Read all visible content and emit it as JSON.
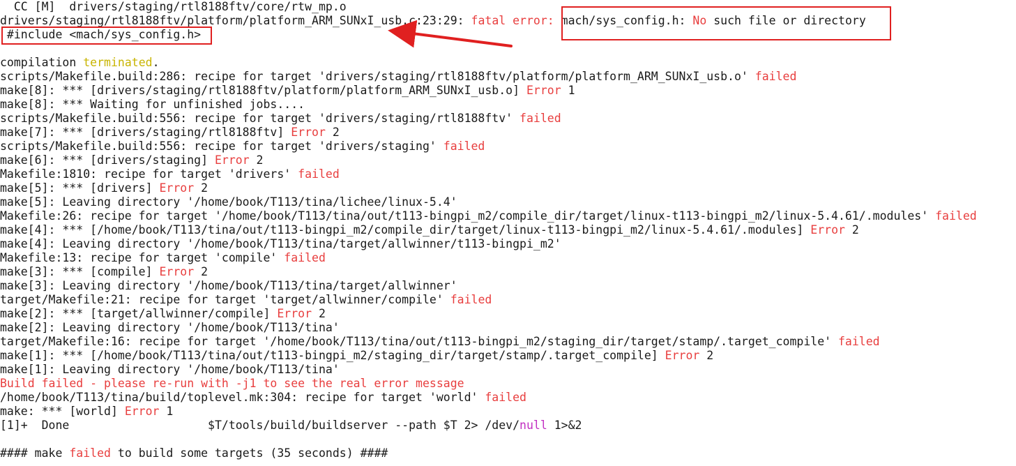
{
  "terminal": {
    "lines": [
      [
        {
          "t": "  CC [M]  drivers/staging/rtl8188ftv/core/rtw_mp.o",
          "c": ""
        }
      ],
      [
        {
          "t": "drivers/staging/rtl8188ftv/platform/platform_ARM_SUNxI_usb.c:23:29: ",
          "c": ""
        },
        {
          "t": "fatal error: ",
          "c": "red"
        },
        {
          "t": "mach/sys_config.h: ",
          "c": ""
        },
        {
          "t": "No",
          "c": "red"
        },
        {
          "t": " such file or directory",
          "c": ""
        }
      ],
      [
        {
          "t": " #include <mach/sys_config.h>",
          "c": ""
        }
      ],
      [
        {
          "t": "",
          "c": ""
        }
      ],
      [
        {
          "t": "compilation ",
          "c": ""
        },
        {
          "t": "terminated",
          "c": "yellow"
        },
        {
          "t": ".",
          "c": ""
        }
      ],
      [
        {
          "t": "scripts/Makefile.build:286: recipe for target 'drivers/staging/rtl8188ftv/platform/platform_ARM_SUNxI_usb.o' ",
          "c": ""
        },
        {
          "t": "failed",
          "c": "red"
        }
      ],
      [
        {
          "t": "make[8]: *** [drivers/staging/rtl8188ftv/platform/platform_ARM_SUNxI_usb.o] ",
          "c": ""
        },
        {
          "t": "Error",
          "c": "red"
        },
        {
          "t": " 1",
          "c": ""
        }
      ],
      [
        {
          "t": "make[8]: *** Waiting for unfinished jobs....",
          "c": ""
        }
      ],
      [
        {
          "t": "scripts/Makefile.build:556: recipe for target 'drivers/staging/rtl8188ftv' ",
          "c": ""
        },
        {
          "t": "failed",
          "c": "red"
        }
      ],
      [
        {
          "t": "make[7]: *** [drivers/staging/rtl8188ftv] ",
          "c": ""
        },
        {
          "t": "Error",
          "c": "red"
        },
        {
          "t": " 2",
          "c": ""
        }
      ],
      [
        {
          "t": "scripts/Makefile.build:556: recipe for target 'drivers/staging' ",
          "c": ""
        },
        {
          "t": "failed",
          "c": "red"
        }
      ],
      [
        {
          "t": "make[6]: *** [drivers/staging] ",
          "c": ""
        },
        {
          "t": "Error",
          "c": "red"
        },
        {
          "t": " 2",
          "c": ""
        }
      ],
      [
        {
          "t": "Makefile:1810: recipe for target 'drivers' ",
          "c": ""
        },
        {
          "t": "failed",
          "c": "red"
        }
      ],
      [
        {
          "t": "make[5]: *** [drivers] ",
          "c": ""
        },
        {
          "t": "Error",
          "c": "red"
        },
        {
          "t": " 2",
          "c": ""
        }
      ],
      [
        {
          "t": "make[5]: Leaving directory '/home/book/T113/tina/lichee/linux-5.4'",
          "c": ""
        }
      ],
      [
        {
          "t": "Makefile:26: recipe for target '/home/book/T113/tina/out/t113-bingpi_m2/compile_dir/target/linux-t113-bingpi_m2/linux-5.4.61/.modules' ",
          "c": ""
        },
        {
          "t": "failed",
          "c": "red"
        }
      ],
      [
        {
          "t": "make[4]: *** [/home/book/T113/tina/out/t113-bingpi_m2/compile_dir/target/linux-t113-bingpi_m2/linux-5.4.61/.modules] ",
          "c": ""
        },
        {
          "t": "Error",
          "c": "red"
        },
        {
          "t": " 2",
          "c": ""
        }
      ],
      [
        {
          "t": "make[4]: Leaving directory '/home/book/T113/tina/target/allwinner/t113-bingpi_m2'",
          "c": ""
        }
      ],
      [
        {
          "t": "Makefile:13: recipe for target 'compile' ",
          "c": ""
        },
        {
          "t": "failed",
          "c": "red"
        }
      ],
      [
        {
          "t": "make[3]: *** [compile] ",
          "c": ""
        },
        {
          "t": "Error",
          "c": "red"
        },
        {
          "t": " 2",
          "c": ""
        }
      ],
      [
        {
          "t": "make[3]: Leaving directory '/home/book/T113/tina/target/allwinner'",
          "c": ""
        }
      ],
      [
        {
          "t": "target/Makefile:21: recipe for target 'target/allwinner/compile' ",
          "c": ""
        },
        {
          "t": "failed",
          "c": "red"
        }
      ],
      [
        {
          "t": "make[2]: *** [target/allwinner/compile] ",
          "c": ""
        },
        {
          "t": "Error",
          "c": "red"
        },
        {
          "t": " 2",
          "c": ""
        }
      ],
      [
        {
          "t": "make[2]: Leaving directory '/home/book/T113/tina'",
          "c": ""
        }
      ],
      [
        {
          "t": "target/Makefile:16: recipe for target '/home/book/T113/tina/out/t113-bingpi_m2/staging_dir/target/stamp/.target_compile' ",
          "c": ""
        },
        {
          "t": "failed",
          "c": "red"
        }
      ],
      [
        {
          "t": "make[1]: *** [/home/book/T113/tina/out/t113-bingpi_m2/staging_dir/target/stamp/.target_compile] ",
          "c": ""
        },
        {
          "t": "Error",
          "c": "red"
        },
        {
          "t": " 2",
          "c": ""
        }
      ],
      [
        {
          "t": "make[1]: Leaving directory '/home/book/T113/tina'",
          "c": ""
        }
      ],
      [
        {
          "t": "Build failed - please re-run with -j1 to see the real error message",
          "c": "red"
        }
      ],
      [
        {
          "t": "/home/book/T113/tina/build/toplevel.mk:304: recipe for target 'world' ",
          "c": ""
        },
        {
          "t": "failed",
          "c": "red"
        }
      ],
      [
        {
          "t": "make: *** [world] ",
          "c": ""
        },
        {
          "t": "Error",
          "c": "red"
        },
        {
          "t": " 1",
          "c": ""
        }
      ],
      [
        {
          "t": "[1]+  Done                    $T/tools/build/buildserver --path $T 2> /dev/",
          "c": ""
        },
        {
          "t": "null",
          "c": "magenta"
        },
        {
          "t": " 1>&2",
          "c": ""
        }
      ],
      [
        {
          "t": "",
          "c": ""
        }
      ],
      [
        {
          "t": "#### make ",
          "c": ""
        },
        {
          "t": "failed",
          "c": "red"
        },
        {
          "t": " to build some targets (35 seconds) ####",
          "c": ""
        }
      ]
    ]
  },
  "colors": {
    "background": "#ffffff",
    "text": "#1a1a1a",
    "error_red": "#e83e3e",
    "warning_yellow": "#c8b400",
    "keyword_magenta": "#c230c2",
    "annotation_red": "#e02020"
  },
  "annotations": {
    "highlight_boxes": [
      "error-message-box",
      "include-line-box"
    ],
    "arrow": "arrow-pointing-to-error"
  }
}
